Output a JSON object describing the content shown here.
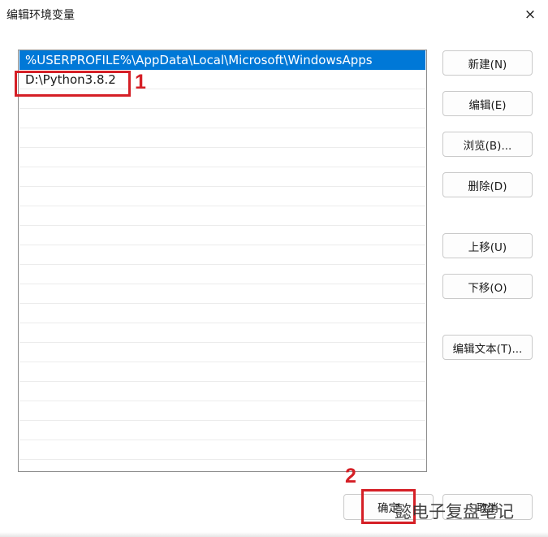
{
  "window": {
    "title": "编辑环境变量",
    "close_icon": "×"
  },
  "path_list": {
    "items": [
      {
        "text": "%USERPROFILE%\\AppData\\Local\\Microsoft\\WindowsApps",
        "selected": true
      },
      {
        "text": "D:\\Python3.8.2",
        "selected": false
      }
    ],
    "empty_rows": 19
  },
  "buttons": {
    "new": "新建(N)",
    "edit": "编辑(E)",
    "browse": "浏览(B)...",
    "delete": "删除(D)",
    "move_up": "上移(U)",
    "move_down": "下移(O)",
    "edit_text": "编辑文本(T)...",
    "ok": "确定",
    "cancel": "取消"
  },
  "annotations": {
    "label_1": "1",
    "label_2": "2",
    "color": "#d51f26"
  },
  "watermark": {
    "text": "电子复盘笔记",
    "prefix": "懿"
  },
  "colors": {
    "selection": "#0078d7",
    "annotation_red": "#d51f26"
  }
}
